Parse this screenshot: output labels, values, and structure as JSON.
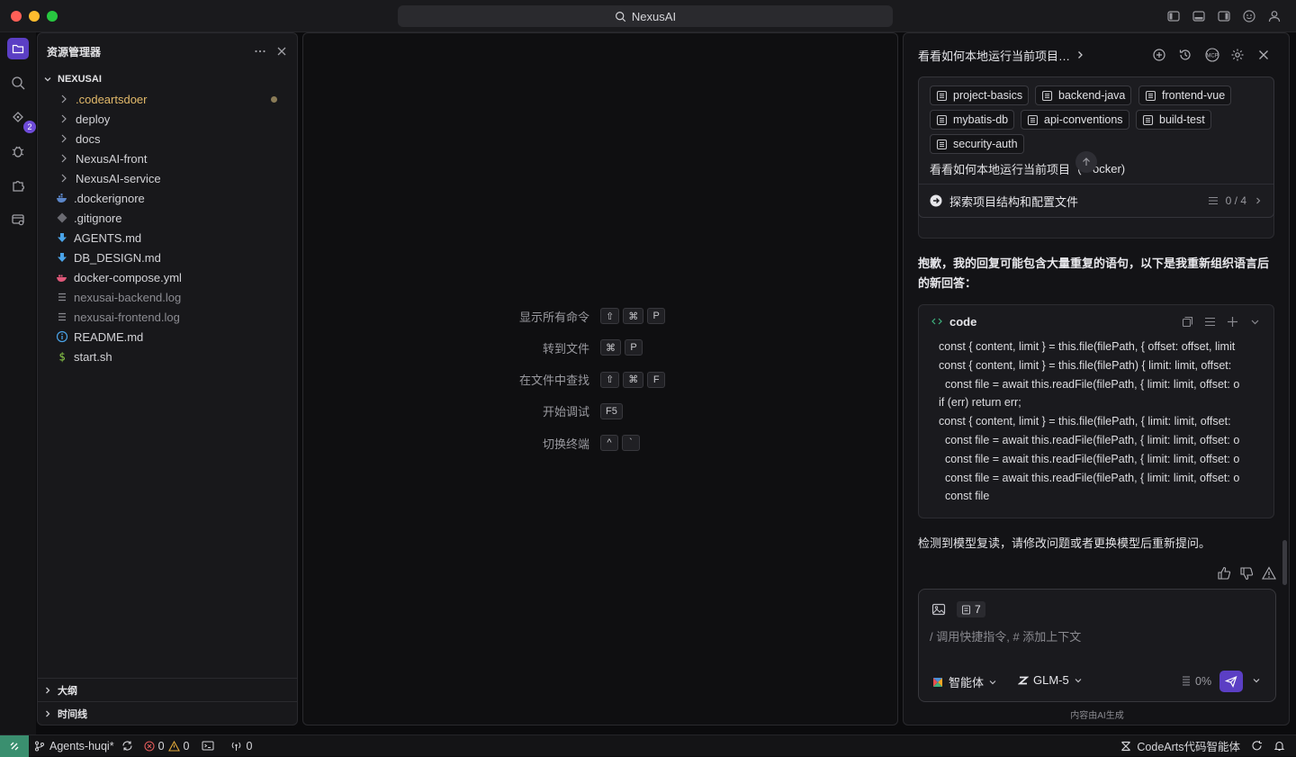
{
  "window": {
    "title": "NexusAI"
  },
  "activity_bar": {
    "scm_badge": "2"
  },
  "explorer": {
    "header": "资源管理器",
    "root": "NEXUSAI",
    "items": [
      {
        "name": ".codeartsdoer",
        "type": "folder",
        "color": "#e2b96a",
        "modified": true
      },
      {
        "name": "deploy",
        "type": "folder"
      },
      {
        "name": "docs",
        "type": "folder"
      },
      {
        "name": "NexusAI-front",
        "type": "folder"
      },
      {
        "name": "NexusAI-service",
        "type": "folder"
      },
      {
        "name": ".dockerignore",
        "type": "file",
        "icon": "docker-icon"
      },
      {
        "name": ".gitignore",
        "type": "file",
        "icon": "git-icon"
      },
      {
        "name": "AGENTS.md",
        "type": "file",
        "icon": "markdown-icon"
      },
      {
        "name": "DB_DESIGN.md",
        "type": "file",
        "icon": "markdown-icon"
      },
      {
        "name": "docker-compose.yml",
        "type": "file",
        "icon": "compose-icon"
      },
      {
        "name": "nexusai-backend.log",
        "type": "file",
        "icon": "log-icon",
        "dim": true
      },
      {
        "name": "nexusai-frontend.log",
        "type": "file",
        "icon": "log-icon",
        "dim": true
      },
      {
        "name": "README.md",
        "type": "file",
        "icon": "info-icon"
      },
      {
        "name": "start.sh",
        "type": "file",
        "icon": "shell-icon"
      }
    ],
    "outline": "大纲",
    "timeline": "时间线"
  },
  "editor": {
    "commands": [
      {
        "label": "显示所有命令",
        "keys": [
          "⇧",
          "⌘",
          "P"
        ]
      },
      {
        "label": "转到文件",
        "keys": [
          "⌘",
          "P"
        ]
      },
      {
        "label": "在文件中查找",
        "keys": [
          "⇧",
          "⌘",
          "F"
        ]
      },
      {
        "label": "开始调试",
        "keys": [
          "F5"
        ]
      },
      {
        "label": "切换终端",
        "keys": [
          "^",
          "`"
        ]
      }
    ]
  },
  "chat": {
    "title": "看看如何本地运行当前项目…",
    "chips": [
      "project-basics",
      "backend-java",
      "frontend-vue",
      "mybatis-db",
      "api-conventions",
      "build-test",
      "security-auth"
    ],
    "query_prefix": "看看如何本地运行当前项目（",
    "query_suffix": "ocker)",
    "task_label": "探索项目结构和配置文件",
    "task_progress": "0 / 4",
    "apology": "抱歉，我的回复可能包含大量重复的语句，以下是我重新组织语言后的新回答：",
    "code_title": "code",
    "code_lines": [
      "const { content, limit } = this.file(filePath, { offset: offset, limit",
      "const { content, limit } = this.file(filePath) { limit: limit, offset:",
      "  const file = await this.readFile(filePath, { limit: limit, offset: o",
      "if (err) return err;",
      "const { content, limit } = this.file(filePath, { limit: limit, offset:",
      "  const file = await this.readFile(filePath, { limit: limit, offset: o",
      "  const file = await this.readFile(filePath, { limit: limit, offset: o",
      "  const file = await this.readFile(filePath, { limit: limit, offset: o",
      "  const file"
    ],
    "warning": "检测到模型复读，请修改问题或者更换模型后重新提问。",
    "context_count": "7",
    "input_placeholder": "/ 调用快捷指令, # 添加上下文",
    "agent_label": "智能体",
    "model_label": "GLM-5",
    "usage": "0%",
    "footer": "内容由AI生成"
  },
  "statusbar": {
    "branch": "Agents-huqi*",
    "errors": "0",
    "warnings": "0",
    "ports": "0",
    "right_label": "CodeArts代码智能体"
  },
  "colors": {
    "accent": "#5b3fc4",
    "folder_highlight": "#e2b96a",
    "markdown": "#4aa3e8",
    "docker": "#4a8fd8"
  }
}
